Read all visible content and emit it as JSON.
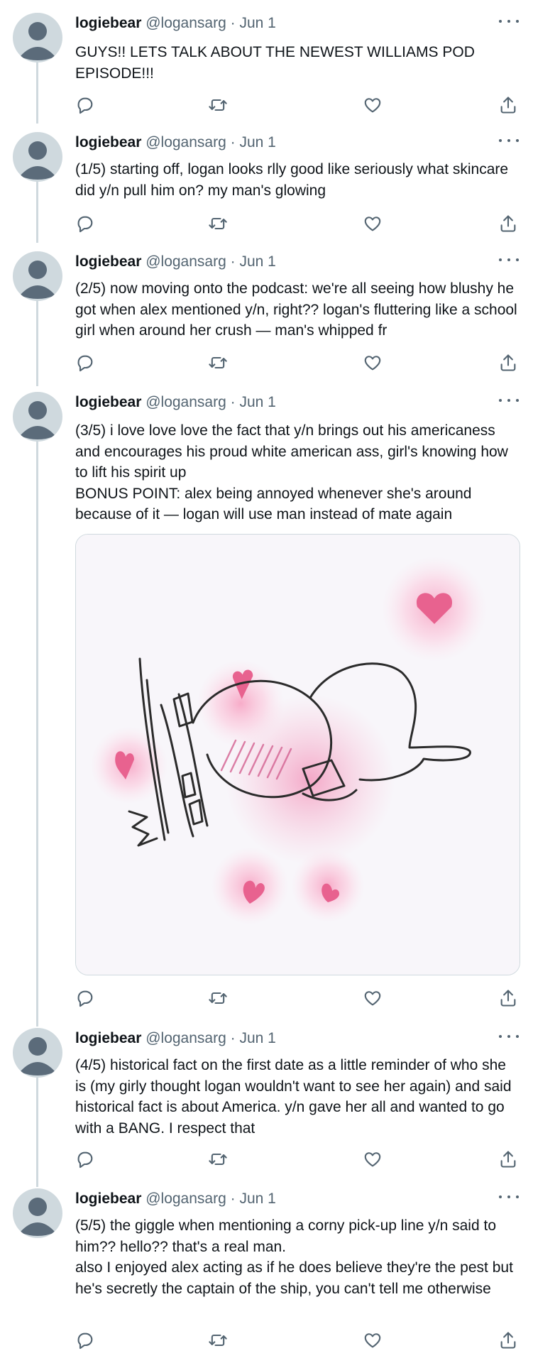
{
  "author": {
    "name": "logiebear",
    "handle": "@logansarg",
    "date": "Jun 1",
    "separator": " · "
  },
  "tweets": [
    {
      "text": "GUYS!! LETS TALK ABOUT THE NEWEST WILLIAMS POD EPISODE!!!"
    },
    {
      "text": "(1/5) starting off, logan looks rlly good like seriously what skincare did y/n pull him on? my man's glowing"
    },
    {
      "text": "(2/5) now moving onto the podcast: we're all seeing how blushy he got when alex mentioned y/n, right?? logan's fluttering like a school girl when around her crush — man's whipped fr"
    },
    {
      "text": "(3/5) i love love love the fact that y/n brings out his americaness and encourages his proud white american ass, girl's knowing how to lift his spirit up\nBONUS POINT: alex being annoyed whenever she's around because of it — logan will use man instead of mate again"
    },
    {
      "text": "(4/5) historical fact on the first date as a little reminder of who she is (my girly thought logan wouldn't want to see her again) and said historical fact is about America. y/n gave her all and wanted to go with a BANG. I respect that"
    },
    {
      "text": "(5/5) the giggle when mentioning a corny pick-up line y/n said to him?? hello?? that's a real man.\nalso I enjoyed alex acting as if he does believe they're the pest but he's secretly the captain of the ship, you can't tell me otherwise"
    }
  ],
  "icons": {
    "reply": "reply-icon",
    "retweet": "retweet-icon",
    "like": "heart-icon",
    "share": "share-icon",
    "more": "more-icon"
  },
  "colors": {
    "text": "#0f1419",
    "secondary": "#536471",
    "thread_line": "#cfd9de",
    "avatar_bg": "#cfd9de",
    "avatar_fg": "#5b6b7a",
    "heart_pink": "#e8628f"
  }
}
